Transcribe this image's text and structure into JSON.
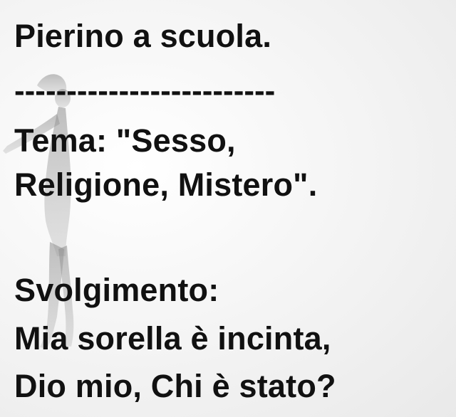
{
  "text": {
    "title": "Pierino a scuola.",
    "separator": "-------------------------",
    "theme_line_1": "Tema:  \"Sesso,",
    "theme_line_2": "Religione, Mistero\".",
    "heading": "Svolgimento:",
    "body_line_1": "Mia sorella è incinta,",
    "body_line_2": "Dio mio, Chi è stato?"
  },
  "colors": {
    "text": "#111111",
    "background": "#f4f4f4",
    "silhouette": "#9a9a9a"
  },
  "decoration": {
    "background_image": "woman-silhouette-icon"
  }
}
